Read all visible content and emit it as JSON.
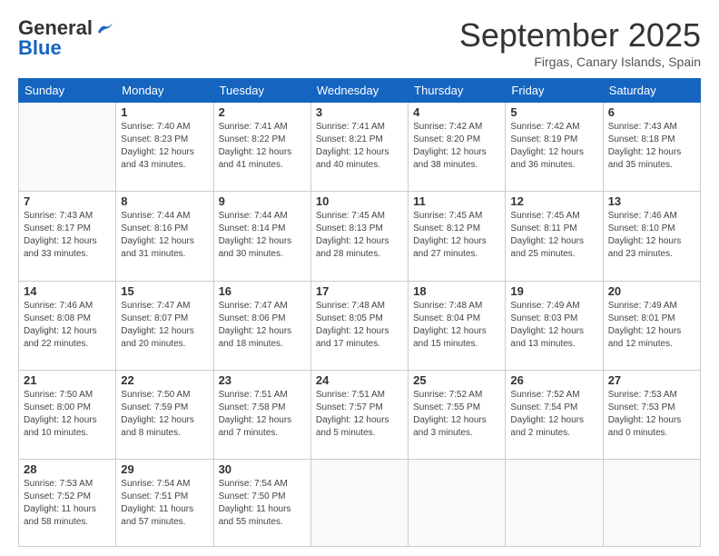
{
  "header": {
    "logo_general": "General",
    "logo_blue": "Blue",
    "month_title": "September 2025",
    "subtitle": "Firgas, Canary Islands, Spain"
  },
  "days_of_week": [
    "Sunday",
    "Monday",
    "Tuesday",
    "Wednesday",
    "Thursday",
    "Friday",
    "Saturday"
  ],
  "weeks": [
    [
      {
        "day": "",
        "info": ""
      },
      {
        "day": "1",
        "info": "Sunrise: 7:40 AM\nSunset: 8:23 PM\nDaylight: 12 hours\nand 43 minutes."
      },
      {
        "day": "2",
        "info": "Sunrise: 7:41 AM\nSunset: 8:22 PM\nDaylight: 12 hours\nand 41 minutes."
      },
      {
        "day": "3",
        "info": "Sunrise: 7:41 AM\nSunset: 8:21 PM\nDaylight: 12 hours\nand 40 minutes."
      },
      {
        "day": "4",
        "info": "Sunrise: 7:42 AM\nSunset: 8:20 PM\nDaylight: 12 hours\nand 38 minutes."
      },
      {
        "day": "5",
        "info": "Sunrise: 7:42 AM\nSunset: 8:19 PM\nDaylight: 12 hours\nand 36 minutes."
      },
      {
        "day": "6",
        "info": "Sunrise: 7:43 AM\nSunset: 8:18 PM\nDaylight: 12 hours\nand 35 minutes."
      }
    ],
    [
      {
        "day": "7",
        "info": "Sunrise: 7:43 AM\nSunset: 8:17 PM\nDaylight: 12 hours\nand 33 minutes."
      },
      {
        "day": "8",
        "info": "Sunrise: 7:44 AM\nSunset: 8:16 PM\nDaylight: 12 hours\nand 31 minutes."
      },
      {
        "day": "9",
        "info": "Sunrise: 7:44 AM\nSunset: 8:14 PM\nDaylight: 12 hours\nand 30 minutes."
      },
      {
        "day": "10",
        "info": "Sunrise: 7:45 AM\nSunset: 8:13 PM\nDaylight: 12 hours\nand 28 minutes."
      },
      {
        "day": "11",
        "info": "Sunrise: 7:45 AM\nSunset: 8:12 PM\nDaylight: 12 hours\nand 27 minutes."
      },
      {
        "day": "12",
        "info": "Sunrise: 7:45 AM\nSunset: 8:11 PM\nDaylight: 12 hours\nand 25 minutes."
      },
      {
        "day": "13",
        "info": "Sunrise: 7:46 AM\nSunset: 8:10 PM\nDaylight: 12 hours\nand 23 minutes."
      }
    ],
    [
      {
        "day": "14",
        "info": "Sunrise: 7:46 AM\nSunset: 8:08 PM\nDaylight: 12 hours\nand 22 minutes."
      },
      {
        "day": "15",
        "info": "Sunrise: 7:47 AM\nSunset: 8:07 PM\nDaylight: 12 hours\nand 20 minutes."
      },
      {
        "day": "16",
        "info": "Sunrise: 7:47 AM\nSunset: 8:06 PM\nDaylight: 12 hours\nand 18 minutes."
      },
      {
        "day": "17",
        "info": "Sunrise: 7:48 AM\nSunset: 8:05 PM\nDaylight: 12 hours\nand 17 minutes."
      },
      {
        "day": "18",
        "info": "Sunrise: 7:48 AM\nSunset: 8:04 PM\nDaylight: 12 hours\nand 15 minutes."
      },
      {
        "day": "19",
        "info": "Sunrise: 7:49 AM\nSunset: 8:03 PM\nDaylight: 12 hours\nand 13 minutes."
      },
      {
        "day": "20",
        "info": "Sunrise: 7:49 AM\nSunset: 8:01 PM\nDaylight: 12 hours\nand 12 minutes."
      }
    ],
    [
      {
        "day": "21",
        "info": "Sunrise: 7:50 AM\nSunset: 8:00 PM\nDaylight: 12 hours\nand 10 minutes."
      },
      {
        "day": "22",
        "info": "Sunrise: 7:50 AM\nSunset: 7:59 PM\nDaylight: 12 hours\nand 8 minutes."
      },
      {
        "day": "23",
        "info": "Sunrise: 7:51 AM\nSunset: 7:58 PM\nDaylight: 12 hours\nand 7 minutes."
      },
      {
        "day": "24",
        "info": "Sunrise: 7:51 AM\nSunset: 7:57 PM\nDaylight: 12 hours\nand 5 minutes."
      },
      {
        "day": "25",
        "info": "Sunrise: 7:52 AM\nSunset: 7:55 PM\nDaylight: 12 hours\nand 3 minutes."
      },
      {
        "day": "26",
        "info": "Sunrise: 7:52 AM\nSunset: 7:54 PM\nDaylight: 12 hours\nand 2 minutes."
      },
      {
        "day": "27",
        "info": "Sunrise: 7:53 AM\nSunset: 7:53 PM\nDaylight: 12 hours\nand 0 minutes."
      }
    ],
    [
      {
        "day": "28",
        "info": "Sunrise: 7:53 AM\nSunset: 7:52 PM\nDaylight: 11 hours\nand 58 minutes."
      },
      {
        "day": "29",
        "info": "Sunrise: 7:54 AM\nSunset: 7:51 PM\nDaylight: 11 hours\nand 57 minutes."
      },
      {
        "day": "30",
        "info": "Sunrise: 7:54 AM\nSunset: 7:50 PM\nDaylight: 11 hours\nand 55 minutes."
      },
      {
        "day": "",
        "info": ""
      },
      {
        "day": "",
        "info": ""
      },
      {
        "day": "",
        "info": ""
      },
      {
        "day": "",
        "info": ""
      }
    ]
  ]
}
